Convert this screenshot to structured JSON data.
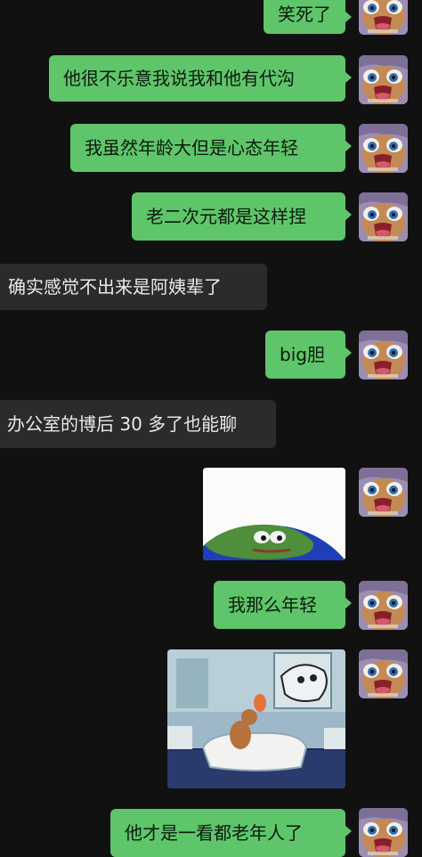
{
  "colors": {
    "sent_bubble": "#5fc56a",
    "received_bubble": "#2b2b2b",
    "background": "#111111"
  },
  "messages": [
    {
      "side": "sent",
      "type": "text",
      "text": "笑死了"
    },
    {
      "side": "sent",
      "type": "text",
      "text": "他很不乐意我说我和他有代沟"
    },
    {
      "side": "sent",
      "type": "text",
      "text": "我虽然年龄大但是心态年轻"
    },
    {
      "side": "sent",
      "type": "text",
      "text": "老二次元都是这样捏"
    },
    {
      "side": "received",
      "type": "text",
      "text": "确实感觉不出来是阿姨辈了"
    },
    {
      "side": "sent",
      "type": "text",
      "text": "big胆"
    },
    {
      "side": "received",
      "type": "text",
      "text": "办公室的博后 30 多了也能聊"
    },
    {
      "side": "sent",
      "type": "image",
      "image": "pepe-frog-sticker"
    },
    {
      "side": "sent",
      "type": "text",
      "text": "我那么年轻"
    },
    {
      "side": "sent",
      "type": "image",
      "image": "tom-and-jerry-bathroom-sticker"
    },
    {
      "side": "sent",
      "type": "text",
      "text": "他才是一看都老年人了"
    }
  ]
}
